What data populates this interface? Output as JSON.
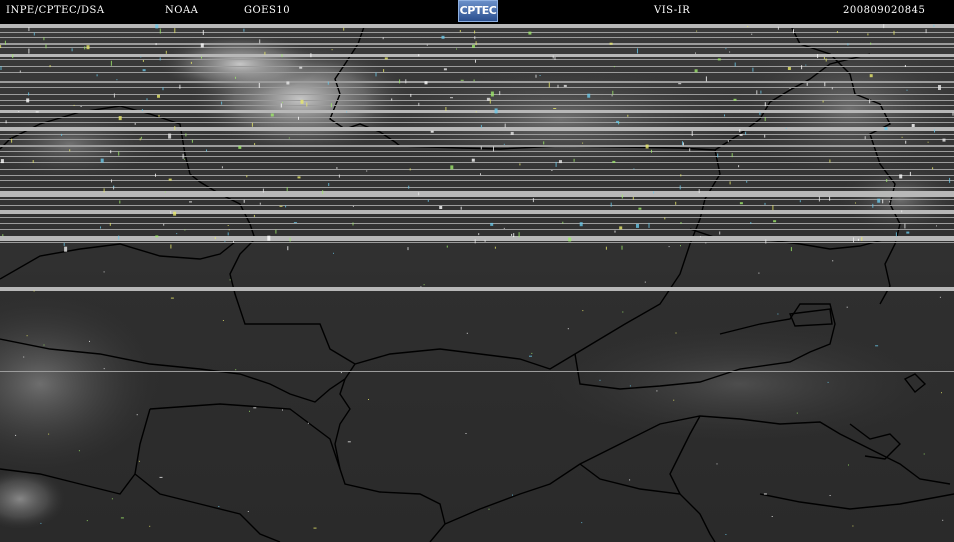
{
  "header": {
    "org": "INPE/CPTEC/DSA",
    "agency": "NOAA",
    "satellite": "GOES10",
    "logo_text": "CPTEC",
    "channel": "VIS-IR",
    "timestamp": "200809020845"
  },
  "colors": {
    "background": "#000000",
    "land": "#2e2e2e",
    "scanline": "#b4b4b4",
    "border": "#000000",
    "cloud": "#cfcfcf"
  }
}
